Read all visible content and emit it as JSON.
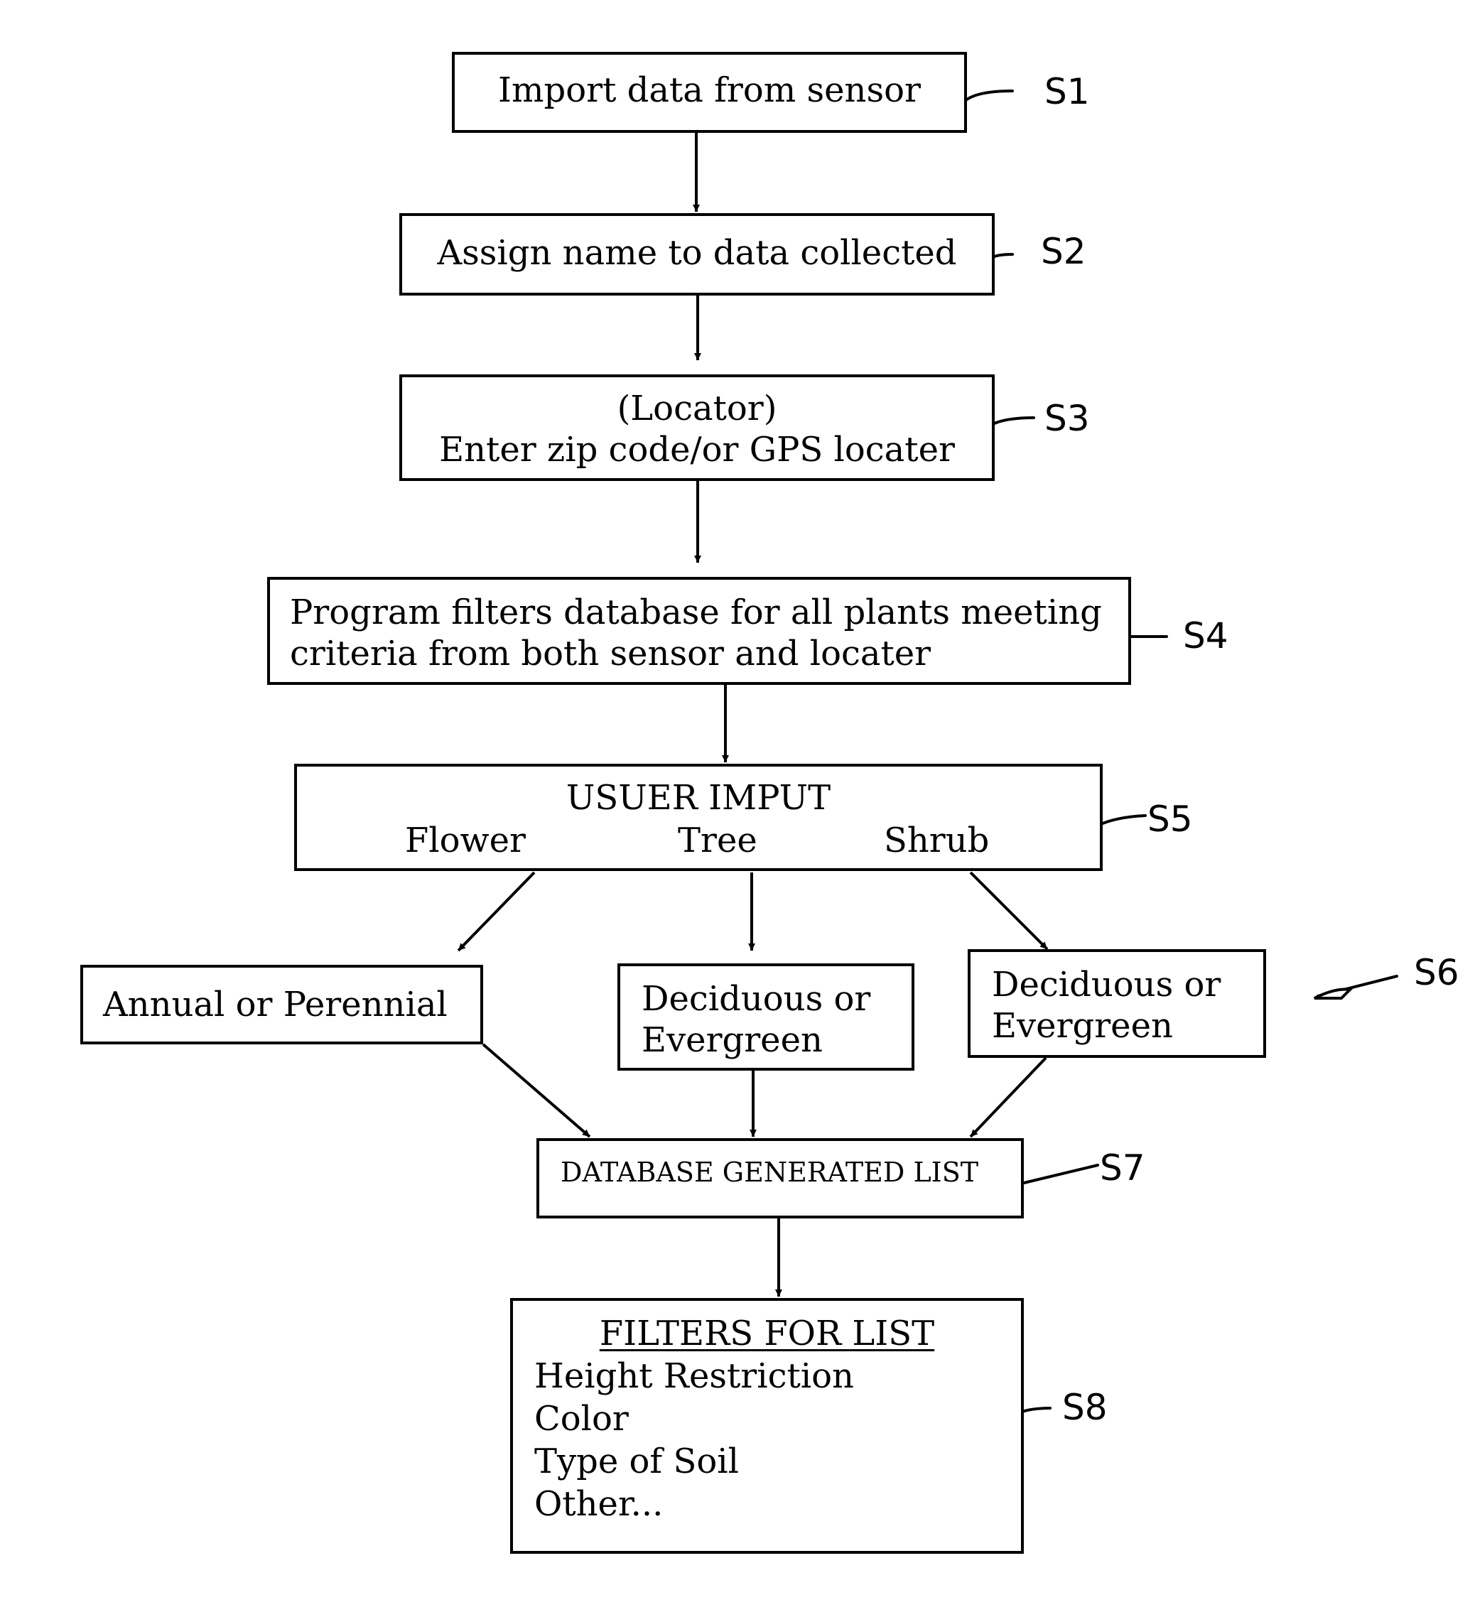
{
  "diagram": {
    "type": "flowchart",
    "steps": [
      {
        "id": "S1",
        "ref": "S1",
        "lines": [
          "Import data from sensor"
        ]
      },
      {
        "id": "S2",
        "ref": "S2",
        "lines": [
          "Assign name to data collected"
        ]
      },
      {
        "id": "S3",
        "ref": "S3",
        "lines": [
          "(Locator)",
          "Enter zip code/or GPS locater"
        ]
      },
      {
        "id": "S4",
        "ref": "S4",
        "lines": [
          "Program filters database for all plants meeting",
          "criteria from both sensor and locater"
        ]
      },
      {
        "id": "S5",
        "ref": "S5",
        "title": "USUER IMPUT",
        "options": [
          "Flower",
          "Tree",
          "Shrub"
        ]
      },
      {
        "id": "S6",
        "ref": "S6",
        "branches": [
          {
            "lines": [
              "Annual or Perennial"
            ]
          },
          {
            "lines": [
              "Deciduous or",
              "Evergreen"
            ]
          },
          {
            "lines": [
              "Deciduous or",
              "Evergreen"
            ]
          }
        ]
      },
      {
        "id": "S7",
        "ref": "S7",
        "lines": [
          "DATABASE GENERATED LIST"
        ]
      },
      {
        "id": "S8",
        "ref": "S8",
        "title": "FILTERS FOR LIST",
        "items": [
          "Height Restriction",
          "Color",
          "Type of Soil",
          "Other..."
        ]
      }
    ],
    "edges": [
      [
        "S1",
        "S2"
      ],
      [
        "S2",
        "S3"
      ],
      [
        "S3",
        "S4"
      ],
      [
        "S4",
        "S5"
      ],
      [
        "S5",
        "S6.0"
      ],
      [
        "S5",
        "S6.1"
      ],
      [
        "S5",
        "S6.2"
      ],
      [
        "S6.0",
        "S7"
      ],
      [
        "S6.1",
        "S7"
      ],
      [
        "S6.2",
        "S7"
      ],
      [
        "S7",
        "S8"
      ]
    ]
  }
}
